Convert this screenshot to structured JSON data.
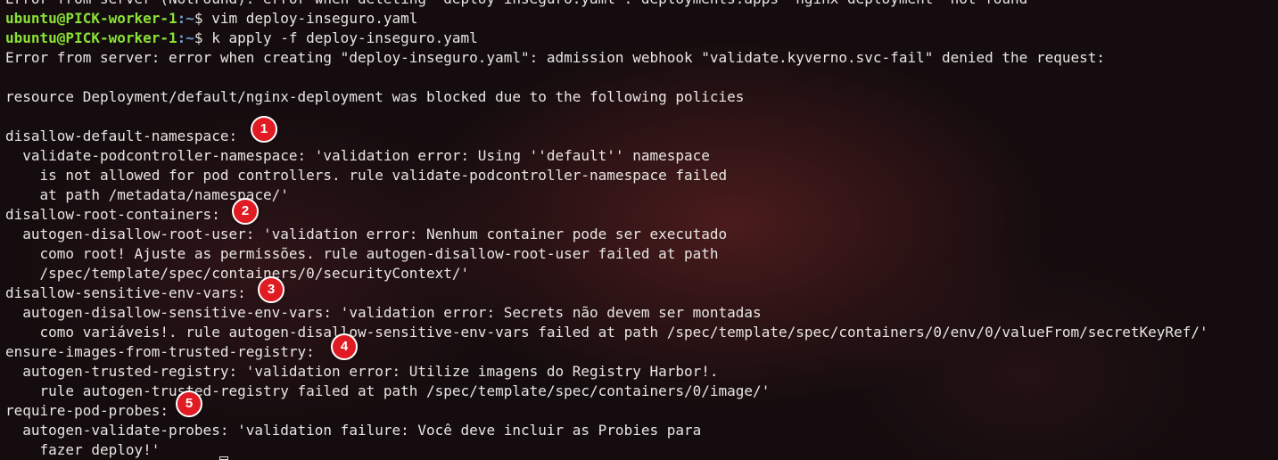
{
  "terminal": {
    "lines": [
      {
        "text": "Error from server (NotFound): error when deleting \"deploy-inseguro.yaml\": deployments.apps \"nginx-deployment\" not found"
      },
      {
        "prompt_user": "ubuntu@PICK-worker-1",
        "prompt_path": ":~",
        "prompt_symbol": "$ ",
        "command": "vim deploy-inseguro.yaml"
      },
      {
        "prompt_user": "ubuntu@PICK-worker-1",
        "prompt_path": ":~",
        "prompt_symbol": "$ ",
        "command": "k apply -f deploy-inseguro.yaml"
      },
      {
        "text": "Error from server: error when creating \"deploy-inseguro.yaml\": admission webhook \"validate.kyverno.svc-fail\" denied the request:"
      },
      {
        "text": ""
      },
      {
        "text": "resource Deployment/default/nginx-deployment was blocked due to the following policies"
      },
      {
        "text": ""
      },
      {
        "text": "disallow-default-namespace:"
      },
      {
        "text": "  validate-podcontroller-namespace: 'validation error: Using ''default'' namespace"
      },
      {
        "text": "    is not allowed for pod controllers. rule validate-podcontroller-namespace failed"
      },
      {
        "text": "    at path /metadata/namespace/'"
      },
      {
        "text": "disallow-root-containers:"
      },
      {
        "text": "  autogen-disallow-root-user: 'validation error: Nenhum container pode ser executado"
      },
      {
        "text": "    como root! Ajuste as permissões. rule autogen-disallow-root-user failed at path"
      },
      {
        "text": "    /spec/template/spec/containers/0/securityContext/'"
      },
      {
        "text": "disallow-sensitive-env-vars:"
      },
      {
        "text": "  autogen-disallow-sensitive-env-vars: 'validation error: Secrets não devem ser montadas"
      },
      {
        "text": "    como variáveis!. rule autogen-disallow-sensitive-env-vars failed at path /spec/template/spec/containers/0/env/0/valueFrom/secretKeyRef/'"
      },
      {
        "text": "ensure-images-from-trusted-registry:"
      },
      {
        "text": "  autogen-trusted-registry: 'validation error: Utilize imagens do Registry Harbor!."
      },
      {
        "text": "    rule autogen-trusted-registry failed at path /spec/template/spec/containers/0/image/'"
      },
      {
        "text": "require-pod-probes:"
      },
      {
        "text": "  autogen-validate-probes: 'validation failure: Você deve incluir as Probies para"
      },
      {
        "text": "    fazer deploy!'"
      }
    ]
  },
  "markers": [
    "1",
    "2",
    "3",
    "4",
    "5"
  ],
  "colors": {
    "prompt_user": "#8ae234",
    "prompt_path": "#729fcf",
    "marker_fill": "#e01b24",
    "text": "#e8e6e3"
  }
}
